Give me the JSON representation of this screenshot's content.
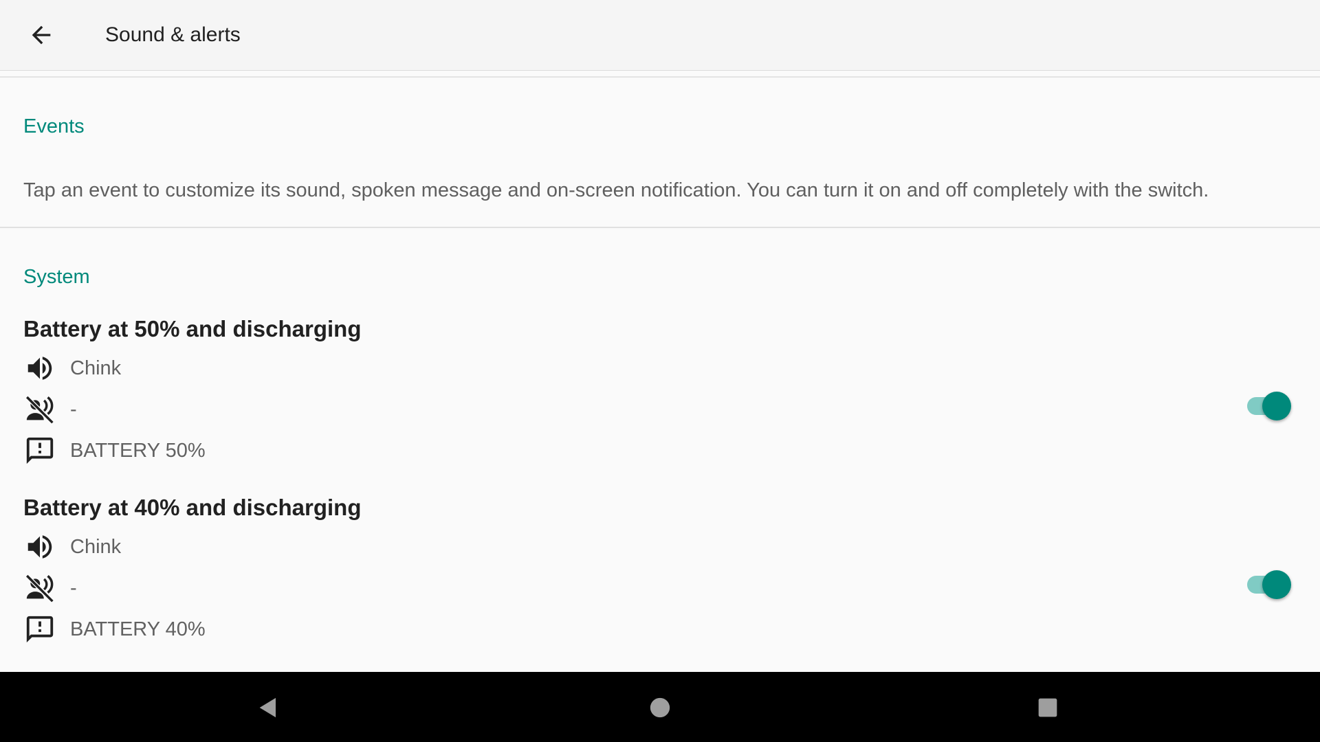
{
  "appbar": {
    "title": "Sound & alerts",
    "back_icon": "arrow-back-icon"
  },
  "events_section": {
    "header": "Events",
    "description": "Tap an event to customize its sound, spoken message and on-screen notification. You can turn it on and off completely with the switch."
  },
  "system_section": {
    "header": "System",
    "events": [
      {
        "title": "Battery at 50% and discharging",
        "sound": "Chink",
        "speech": "-",
        "notification": "BATTERY 50%",
        "enabled": true
      },
      {
        "title": "Battery at 40% and discharging",
        "sound": "Chink",
        "speech": "-",
        "notification": "BATTERY 40%",
        "enabled": true
      }
    ]
  },
  "colors": {
    "accent": "#00897b",
    "accent_track": "#80cbc4",
    "navbar": "#000000"
  },
  "navbar": {
    "back_icon": "nav-back-triangle-icon",
    "home_icon": "nav-home-circle-icon",
    "recents_icon": "nav-recents-square-icon"
  }
}
